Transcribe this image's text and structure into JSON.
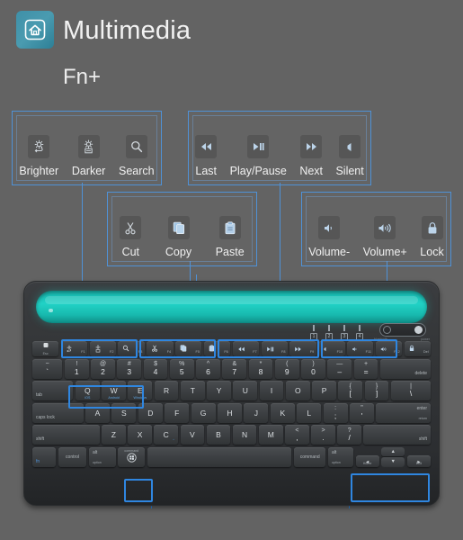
{
  "header": {
    "logo_icon": "home-icon",
    "title": "Multimedia",
    "fn_prefix": "Fn+"
  },
  "accent_color": "#4f91d6",
  "highlight_color": "#2f86e0",
  "background_color": "#636363",
  "keyboard_color": "#343638",
  "slot_color": "#21d2c6",
  "callouts": [
    {
      "name": "brightness-search-group",
      "items": [
        {
          "icon": "brightness-up-icon",
          "label": "Brighter"
        },
        {
          "icon": "brightness-down-icon",
          "label": "Darker"
        },
        {
          "icon": "search-icon",
          "label": "Search"
        }
      ]
    },
    {
      "name": "media-controls-group",
      "items": [
        {
          "icon": "rewind-icon",
          "label": "Last"
        },
        {
          "icon": "play-pause-icon",
          "label": "Play/Pause"
        },
        {
          "icon": "fast-forward-icon",
          "label": "Next"
        },
        {
          "icon": "mute-icon",
          "label": "Silent"
        }
      ]
    },
    {
      "name": "clipboard-group",
      "items": [
        {
          "icon": "cut-icon",
          "label": "Cut"
        },
        {
          "icon": "copy-icon",
          "label": "Copy"
        },
        {
          "icon": "paste-icon",
          "label": "Paste"
        }
      ]
    },
    {
      "name": "volume-lock-group",
      "items": [
        {
          "icon": "volume-down-icon",
          "label": "Volume-"
        },
        {
          "icon": "volume-up-icon",
          "label": "Volume+"
        },
        {
          "icon": "lock-icon",
          "label": "Lock"
        }
      ]
    }
  ],
  "keyboard": {
    "indicators": [
      {
        "name": "caps-lock-indicator",
        "glyph": "1"
      },
      {
        "name": "num-lock-indicator",
        "glyph": "2"
      },
      {
        "name": "battery-indicator",
        "glyph": "3"
      },
      {
        "name": "bluetooth-indicator",
        "glyph": "4"
      }
    ],
    "switch": {
      "name": "bluetooth-power-switch",
      "left_label": "bluetooth",
      "right_label": "power"
    },
    "rows": [
      {
        "name": "function-row",
        "keys": [
          {
            "name": "esc-key",
            "label": "Esc",
            "type": "esc",
            "flex": 1.45
          },
          {
            "name": "f1-key",
            "label": "F1",
            "glyph": "brightness-up-icon",
            "type": "fn",
            "flex": 1.45
          },
          {
            "name": "f2-key",
            "label": "F2",
            "glyph": "brightness-down-icon",
            "type": "fn",
            "flex": 1.45
          },
          {
            "name": "f3-key",
            "label": "F3",
            "glyph": "search-icon",
            "type": "fn",
            "flex": 1.45
          },
          {
            "name": "f4-key",
            "label": "F4",
            "glyph": "cut-icon",
            "type": "fn",
            "flex": 1.45
          },
          {
            "name": "f5-key",
            "label": "F5",
            "glyph": "copy-icon",
            "type": "fn",
            "flex": 1.45
          },
          {
            "name": "f6-key",
            "label": "F6",
            "glyph": "paste-icon",
            "type": "fn",
            "flex": 1.45
          },
          {
            "name": "f7-key",
            "label": "F7",
            "glyph": "rewind-icon",
            "type": "fn",
            "flex": 1.45
          },
          {
            "name": "f8-key",
            "label": "F8",
            "glyph": "play-pause-icon",
            "type": "fn",
            "flex": 1.45
          },
          {
            "name": "f9-key",
            "label": "F9",
            "glyph": "fast-forward-icon",
            "type": "fn",
            "flex": 1.45
          },
          {
            "name": "f10-key",
            "label": "F10",
            "glyph": "mute-icon",
            "type": "fn",
            "flex": 1.45
          },
          {
            "name": "f11-key",
            "label": "F11",
            "glyph": "volume-down-icon",
            "type": "fn",
            "flex": 1.45
          },
          {
            "name": "f12-key",
            "label": "F12",
            "glyph": "volume-up-icon",
            "type": "fn",
            "flex": 1.45
          },
          {
            "name": "del-key",
            "label": "Del",
            "glyph": "lock-icon",
            "type": "fn",
            "flex": 1.45
          }
        ]
      },
      {
        "name": "number-row",
        "keys": [
          {
            "name": "tilde-key",
            "top": "~",
            "bottom": "`",
            "flex": 1.25
          },
          {
            "name": "digit-1-key",
            "top": "!",
            "bottom": "1",
            "flex": 1
          },
          {
            "name": "digit-2-key",
            "top": "@",
            "bottom": "2",
            "flex": 1
          },
          {
            "name": "digit-3-key",
            "top": "#",
            "bottom": "3",
            "flex": 1
          },
          {
            "name": "digit-4-key",
            "top": "$",
            "bottom": "4",
            "flex": 1
          },
          {
            "name": "digit-5-key",
            "top": "%",
            "bottom": "5",
            "flex": 1
          },
          {
            "name": "digit-6-key",
            "top": "^",
            "bottom": "6",
            "flex": 1
          },
          {
            "name": "digit-7-key",
            "top": "&",
            "bottom": "7",
            "flex": 1
          },
          {
            "name": "digit-8-key",
            "top": "*",
            "bottom": "8",
            "flex": 1
          },
          {
            "name": "digit-9-key",
            "top": "(",
            "bottom": "9",
            "flex": 1
          },
          {
            "name": "digit-0-key",
            "top": ")",
            "bottom": "0",
            "flex": 1
          },
          {
            "name": "minus-key",
            "top": "—",
            "bottom": "–",
            "flex": 1
          },
          {
            "name": "equals-key",
            "top": "+",
            "bottom": "=",
            "flex": 1
          },
          {
            "name": "delete-key",
            "label": "delete",
            "type": "word-right",
            "flex": 2.1
          }
        ]
      },
      {
        "name": "qwerty-row",
        "keys": [
          {
            "name": "tab-key",
            "label": "tab",
            "type": "word-left",
            "flex": 1.7
          },
          {
            "name": "q-key",
            "label": "Q",
            "sub": "iOS",
            "flex": 1
          },
          {
            "name": "w-key",
            "label": "W",
            "sub": "Android",
            "flex": 1
          },
          {
            "name": "e-key",
            "label": "E",
            "sub": "Windows",
            "flex": 1
          },
          {
            "name": "r-key",
            "label": "R",
            "flex": 1
          },
          {
            "name": "t-key",
            "label": "T",
            "flex": 1
          },
          {
            "name": "y-key",
            "label": "Y",
            "flex": 1
          },
          {
            "name": "u-key",
            "label": "U",
            "flex": 1
          },
          {
            "name": "i-key",
            "label": "I",
            "flex": 1
          },
          {
            "name": "o-key",
            "label": "O",
            "flex": 1
          },
          {
            "name": "p-key",
            "label": "P",
            "flex": 1
          },
          {
            "name": "bracket-left-key",
            "top": "{",
            "bottom": "[",
            "flex": 1
          },
          {
            "name": "bracket-right-key",
            "top": "}",
            "bottom": "]",
            "flex": 1
          },
          {
            "name": "backslash-key",
            "top": "|",
            "bottom": "\\",
            "flex": 1.65
          }
        ]
      },
      {
        "name": "home-row",
        "keys": [
          {
            "name": "caps-lock-key",
            "label": "caps lock",
            "type": "word-left",
            "flex": 2.1
          },
          {
            "name": "a-key",
            "label": "A",
            "flex": 1
          },
          {
            "name": "s-key",
            "label": "S",
            "flex": 1
          },
          {
            "name": "d-key",
            "label": "D",
            "flex": 1
          },
          {
            "name": "f-key",
            "label": "F",
            "flex": 1
          },
          {
            "name": "g-key",
            "label": "G",
            "flex": 1
          },
          {
            "name": "h-key",
            "label": "H",
            "flex": 1
          },
          {
            "name": "j-key",
            "label": "J",
            "flex": 1
          },
          {
            "name": "k-key",
            "label": "K",
            "flex": 1
          },
          {
            "name": "l-key",
            "label": "L",
            "flex": 1
          },
          {
            "name": "semicolon-key",
            "top": ":",
            "bottom": ";",
            "flex": 1
          },
          {
            "name": "quote-key",
            "top": "\"",
            "bottom": "'",
            "flex": 1
          },
          {
            "name": "enter-key",
            "label": "enter",
            "sublabel": "return",
            "type": "enter",
            "flex": 2.25
          }
        ]
      },
      {
        "name": "shift-row",
        "keys": [
          {
            "name": "shift-left-key",
            "label": "shift",
            "type": "word-left",
            "flex": 2.8
          },
          {
            "name": "z-key",
            "label": "Z",
            "flex": 1
          },
          {
            "name": "x-key",
            "label": "X",
            "flex": 1
          },
          {
            "name": "c-key",
            "label": "C",
            "mark": "◦",
            "flex": 1
          },
          {
            "name": "v-key",
            "label": "V",
            "flex": 1
          },
          {
            "name": "b-key",
            "label": "B",
            "flex": 1
          },
          {
            "name": "n-key",
            "label": "N",
            "flex": 1
          },
          {
            "name": "m-key",
            "label": "M",
            "flex": 1
          },
          {
            "name": "comma-key",
            "top": "<",
            "bottom": ",",
            "flex": 1
          },
          {
            "name": "period-key",
            "top": ">",
            "bottom": ".",
            "flex": 1
          },
          {
            "name": "slash-key",
            "top": "?",
            "bottom": "/",
            "flex": 1
          },
          {
            "name": "shift-right-key",
            "label": "shift",
            "type": "word-right",
            "flex": 2.8
          }
        ]
      },
      {
        "name": "bottom-row",
        "keys": [
          {
            "name": "fn-key",
            "label": "fn",
            "type": "fn-blue",
            "flex": 1.4
          },
          {
            "name": "control-key",
            "label": "control",
            "type": "word",
            "flex": 1.7
          },
          {
            "name": "alt-option-left-key",
            "label": "alt",
            "sublabel": "option",
            "type": "stack",
            "flex": 1.6
          },
          {
            "name": "command-windows-key",
            "label": "command",
            "glyph": "windows-icon",
            "type": "cmd",
            "flex": 1.6
          },
          {
            "name": "space-key",
            "label": "",
            "flex": 8.6
          },
          {
            "name": "command-right-key",
            "label": "command",
            "type": "word",
            "flex": 1.9
          },
          {
            "name": "alt-option-right-key",
            "label": "alt",
            "sublabel": "option",
            "type": "stack",
            "flex": 1.5
          },
          {
            "name": "arrow-left-key",
            "label": "◄",
            "sublabel": "Home",
            "type": "arrow",
            "flex": 1.4
          },
          {
            "name": "arrow-updown-key",
            "label": "▲",
            "sublabel": "▼",
            "type": "arrow-stack",
            "flex": 1.4
          },
          {
            "name": "arrow-right-key",
            "label": "►",
            "sublabel": "End",
            "type": "arrow",
            "flex": 1.4
          }
        ]
      }
    ]
  }
}
